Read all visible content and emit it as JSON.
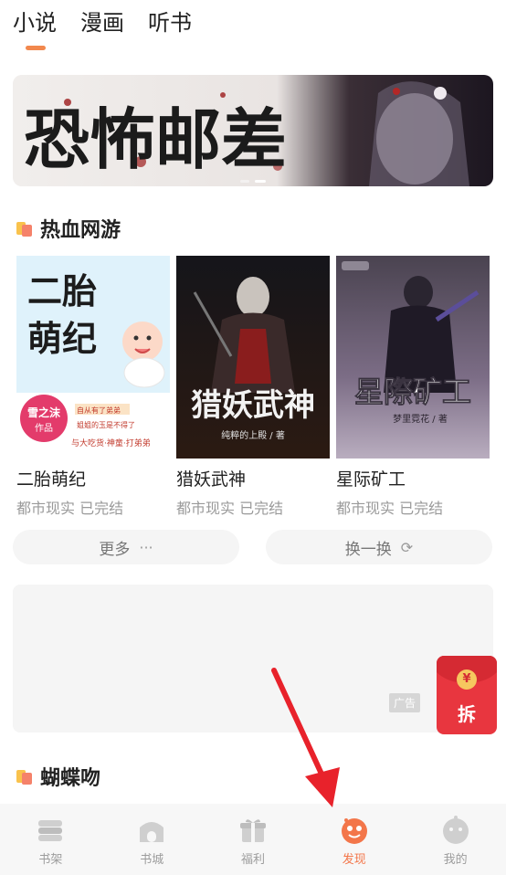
{
  "top_tabs": [
    {
      "label": "小说",
      "active": true
    },
    {
      "label": "漫画",
      "active": false
    },
    {
      "label": "听书",
      "active": false
    }
  ],
  "banner": {
    "title_text": "恐怖邮差",
    "slides": 3,
    "active_slide": 2
  },
  "section1": {
    "title": "热血网游"
  },
  "books": [
    {
      "title": "二胎萌纪",
      "meta": "都市现实 已完结",
      "cover_text_1": "二胎",
      "cover_text_2": "萌纪",
      "cover_author": "雪之沫",
      "cover_author_sub": "作品",
      "cover_blurb_1": "自从有了弟弟",
      "cover_blurb_2": "姐姐的玉是不得了",
      "cover_blurb_3": "与大吃货·神童·打弟弟"
    },
    {
      "title": "猎妖武神",
      "meta": "都市现实 已完结",
      "cover_text": "猎妖武神",
      "cover_author": "纯粹的上殿 / 著"
    },
    {
      "title": "星际矿工",
      "meta": "都市现实 已完结",
      "cover_text": "星際矿工",
      "cover_author": "梦里霓花 / 著"
    }
  ],
  "buttons": {
    "more": "更多",
    "more_glyph": "···",
    "refresh": "换一换",
    "refresh_glyph": "⟳"
  },
  "ad": {
    "label": "广告"
  },
  "envelope": {
    "coin": "¥",
    "label": "拆"
  },
  "section2": {
    "title": "蝴蝶吻"
  },
  "bottom_nav": [
    {
      "label": "书架",
      "icon": "bookshelf-icon",
      "active": false
    },
    {
      "label": "书城",
      "icon": "bookstore-icon",
      "active": false
    },
    {
      "label": "福利",
      "icon": "gift-icon",
      "active": false
    },
    {
      "label": "发现",
      "icon": "discover-icon",
      "active": true
    },
    {
      "label": "我的",
      "icon": "profile-icon",
      "active": false
    }
  ],
  "colors": {
    "accent": "#f3764a",
    "tab_underline": "#f2884d",
    "envelope": "#e8363f",
    "annotation_arrow": "#e8222b"
  }
}
